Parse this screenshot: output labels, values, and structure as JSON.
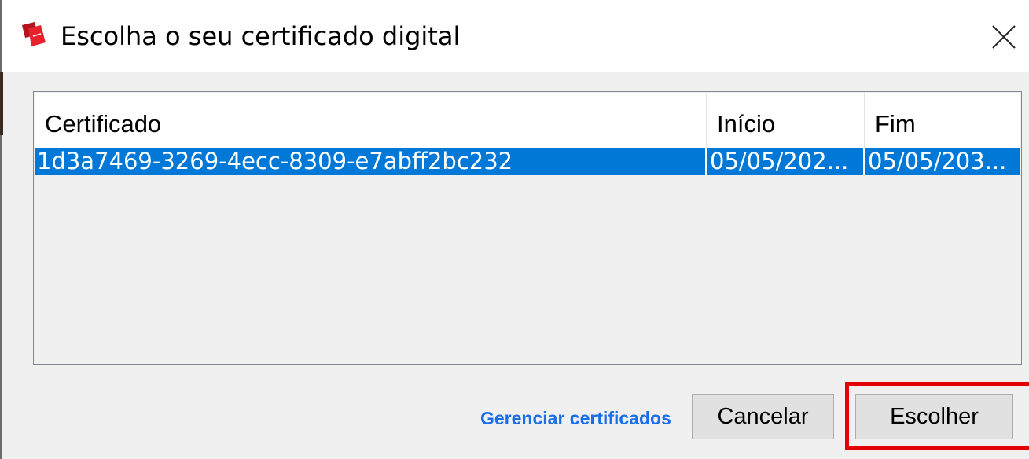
{
  "window": {
    "title": "Escolha o seu certificado digital",
    "icon": "pdf-app-icon",
    "close_icon": "close-icon"
  },
  "table": {
    "columns": [
      "Certificado",
      "Início",
      "Fim"
    ],
    "rows": [
      {
        "certificate": "1d3a7469-3269-4ecc-8309-e7abff2bc232",
        "start": "05/05/202...",
        "end": "05/05/203...",
        "selected": true
      }
    ]
  },
  "footer": {
    "manage_link": "Gerenciar certificados",
    "cancel_label": "Cancelar",
    "choose_label": "Escolher"
  },
  "colors": {
    "selection": "#0078d7",
    "link": "#1a6ee8",
    "highlight_box": "#e60000"
  }
}
